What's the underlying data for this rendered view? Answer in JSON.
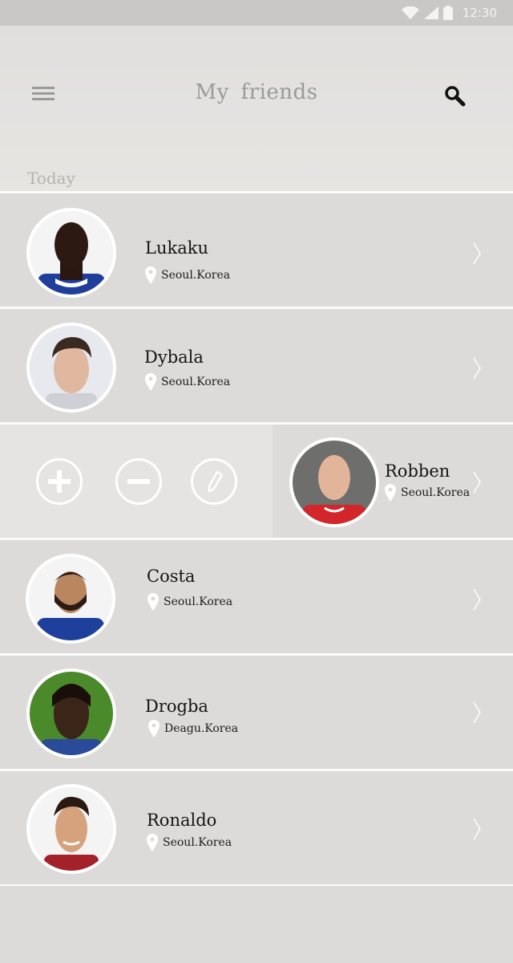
{
  "status_bar": {
    "time": "12:30"
  },
  "header": {
    "title": "My  friends",
    "menu_icon": "hamburger-menu-icon",
    "search_icon": "search-icon"
  },
  "section": {
    "label": "Today"
  },
  "friends": [
    {
      "name": "Lukaku",
      "location": "Seoul.Korea"
    },
    {
      "name": "Dybala",
      "location": "Seoul.Korea"
    },
    {
      "name": "Robben",
      "location": "Seoul.Korea",
      "swiped": true,
      "actions": [
        "add-icon",
        "remove-icon",
        "edit-icon"
      ]
    },
    {
      "name": "Costa",
      "location": "Seoul.Korea"
    },
    {
      "name": "Drogba",
      "location": "Deagu.Korea"
    },
    {
      "name": "Ronaldo",
      "location": "Seoul.Korea"
    }
  ],
  "colors": {
    "background": "#dcdbda",
    "header": "#e3e2e0",
    "divider": "#fbfbfa",
    "accent_gray": "#9a9a9a"
  }
}
